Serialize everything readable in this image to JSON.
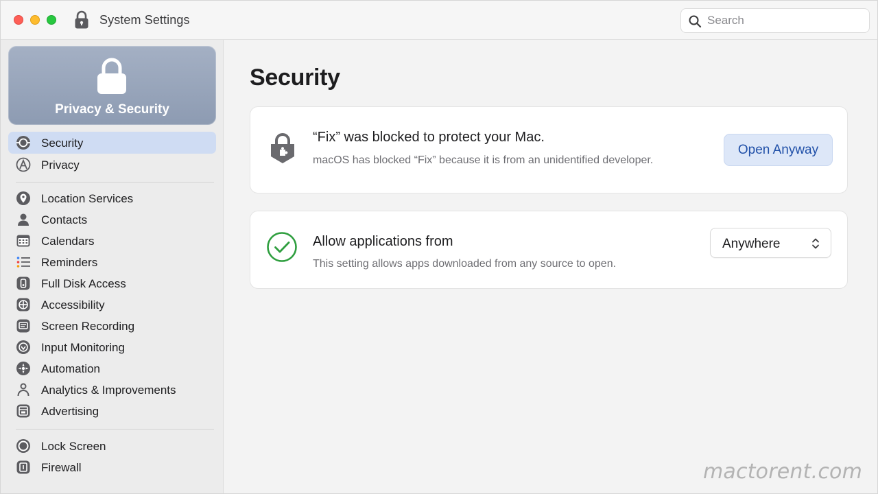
{
  "window": {
    "title": "System Settings"
  },
  "search": {
    "placeholder": "Search",
    "value": ""
  },
  "sidebar": {
    "header": {
      "title": "Privacy & Security"
    },
    "items": [
      {
        "label": "Security",
        "icon": "security-icon",
        "selected": true
      },
      {
        "label": "Privacy",
        "icon": "privacy-icon",
        "selected": false
      },
      {
        "label": "Location Services",
        "icon": "location-icon",
        "selected": false
      },
      {
        "label": "Contacts",
        "icon": "contacts-icon",
        "selected": false
      },
      {
        "label": "Calendars",
        "icon": "calendar-icon",
        "selected": false
      },
      {
        "label": "Reminders",
        "icon": "reminders-icon",
        "selected": false
      },
      {
        "label": "Full Disk Access",
        "icon": "disk-icon",
        "selected": false
      },
      {
        "label": "Accessibility",
        "icon": "accessibility-icon",
        "selected": false
      },
      {
        "label": "Screen Recording",
        "icon": "screen-recording-icon",
        "selected": false
      },
      {
        "label": "Input Monitoring",
        "icon": "input-monitoring-icon",
        "selected": false
      },
      {
        "label": "Automation",
        "icon": "automation-icon",
        "selected": false
      },
      {
        "label": "Analytics & Improvements",
        "icon": "analytics-icon",
        "selected": false
      },
      {
        "label": "Advertising",
        "icon": "advertising-icon",
        "selected": false
      },
      {
        "label": "Lock Screen",
        "icon": "lock-screen-icon",
        "selected": false
      },
      {
        "label": "Firewall",
        "icon": "firewall-icon",
        "selected": false
      }
    ]
  },
  "main": {
    "title": "Security",
    "blocked_card": {
      "title": "“Fix” was blocked to protect your Mac.",
      "subtitle": "macOS has blocked “Fix” because it is from an unidentified developer.",
      "button_label": "Open Anyway"
    },
    "allow_card": {
      "title": "Allow applications from",
      "subtitle": "This setting allows apps downloaded from any source to open.",
      "selected_option": "Anywhere"
    }
  },
  "watermark": "mactorent.com",
  "colors": {
    "accent": "#1f4fa8",
    "selection": "#cfdcf3",
    "hero_gradient_top": "#a4b0c4",
    "hero_gradient_bottom": "#8d9bb2",
    "check_green": "#2e9e3e",
    "close": "#fe5f57",
    "minimize": "#febc2e",
    "zoom": "#28c840"
  }
}
